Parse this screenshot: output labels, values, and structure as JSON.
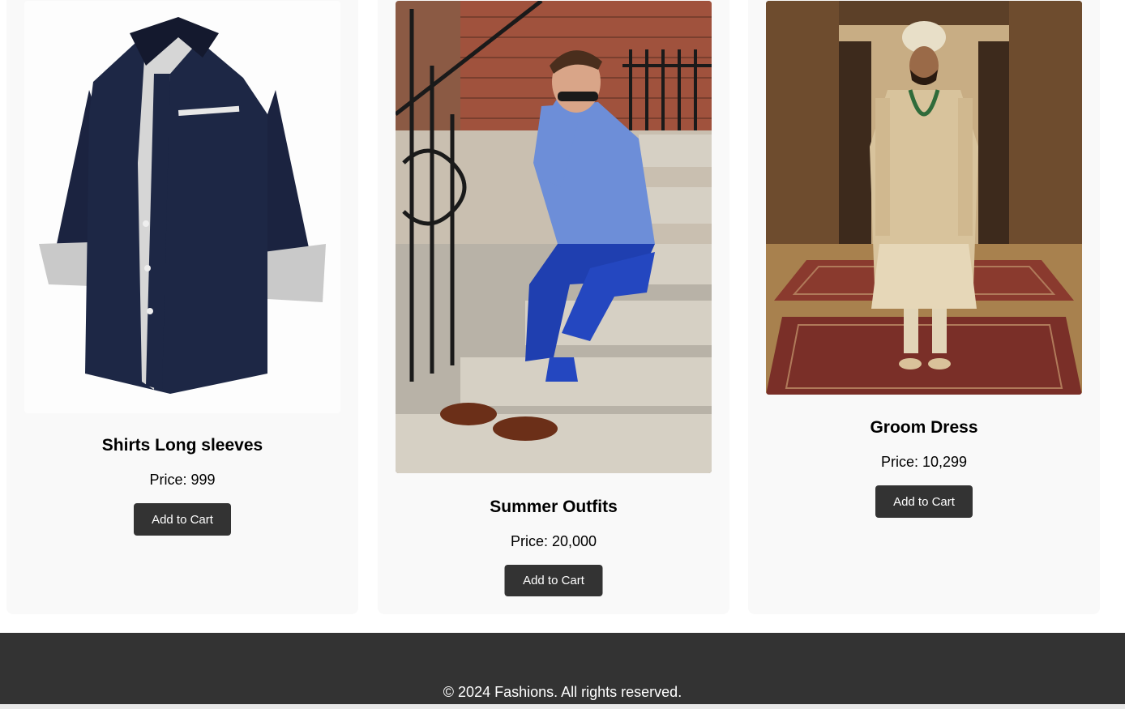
{
  "products": [
    {
      "name": "Shirts Long sleeves",
      "price": "Price: 999",
      "button": "Add to Cart",
      "image_icon": "shirt-image"
    },
    {
      "name": "Summer Outfits",
      "price": "Price: 20,000",
      "button": "Add to Cart",
      "image_icon": "summer-outfit-image"
    },
    {
      "name": "Groom Dress",
      "price": "Price: 10,299",
      "button": "Add to Cart",
      "image_icon": "groom-dress-image"
    }
  ],
  "footer": {
    "copyright": "© 2024 Fashions. All rights reserved."
  },
  "colors": {
    "card_bg": "#f9f9f9",
    "button_bg": "#333333",
    "footer_bg": "#333333"
  }
}
